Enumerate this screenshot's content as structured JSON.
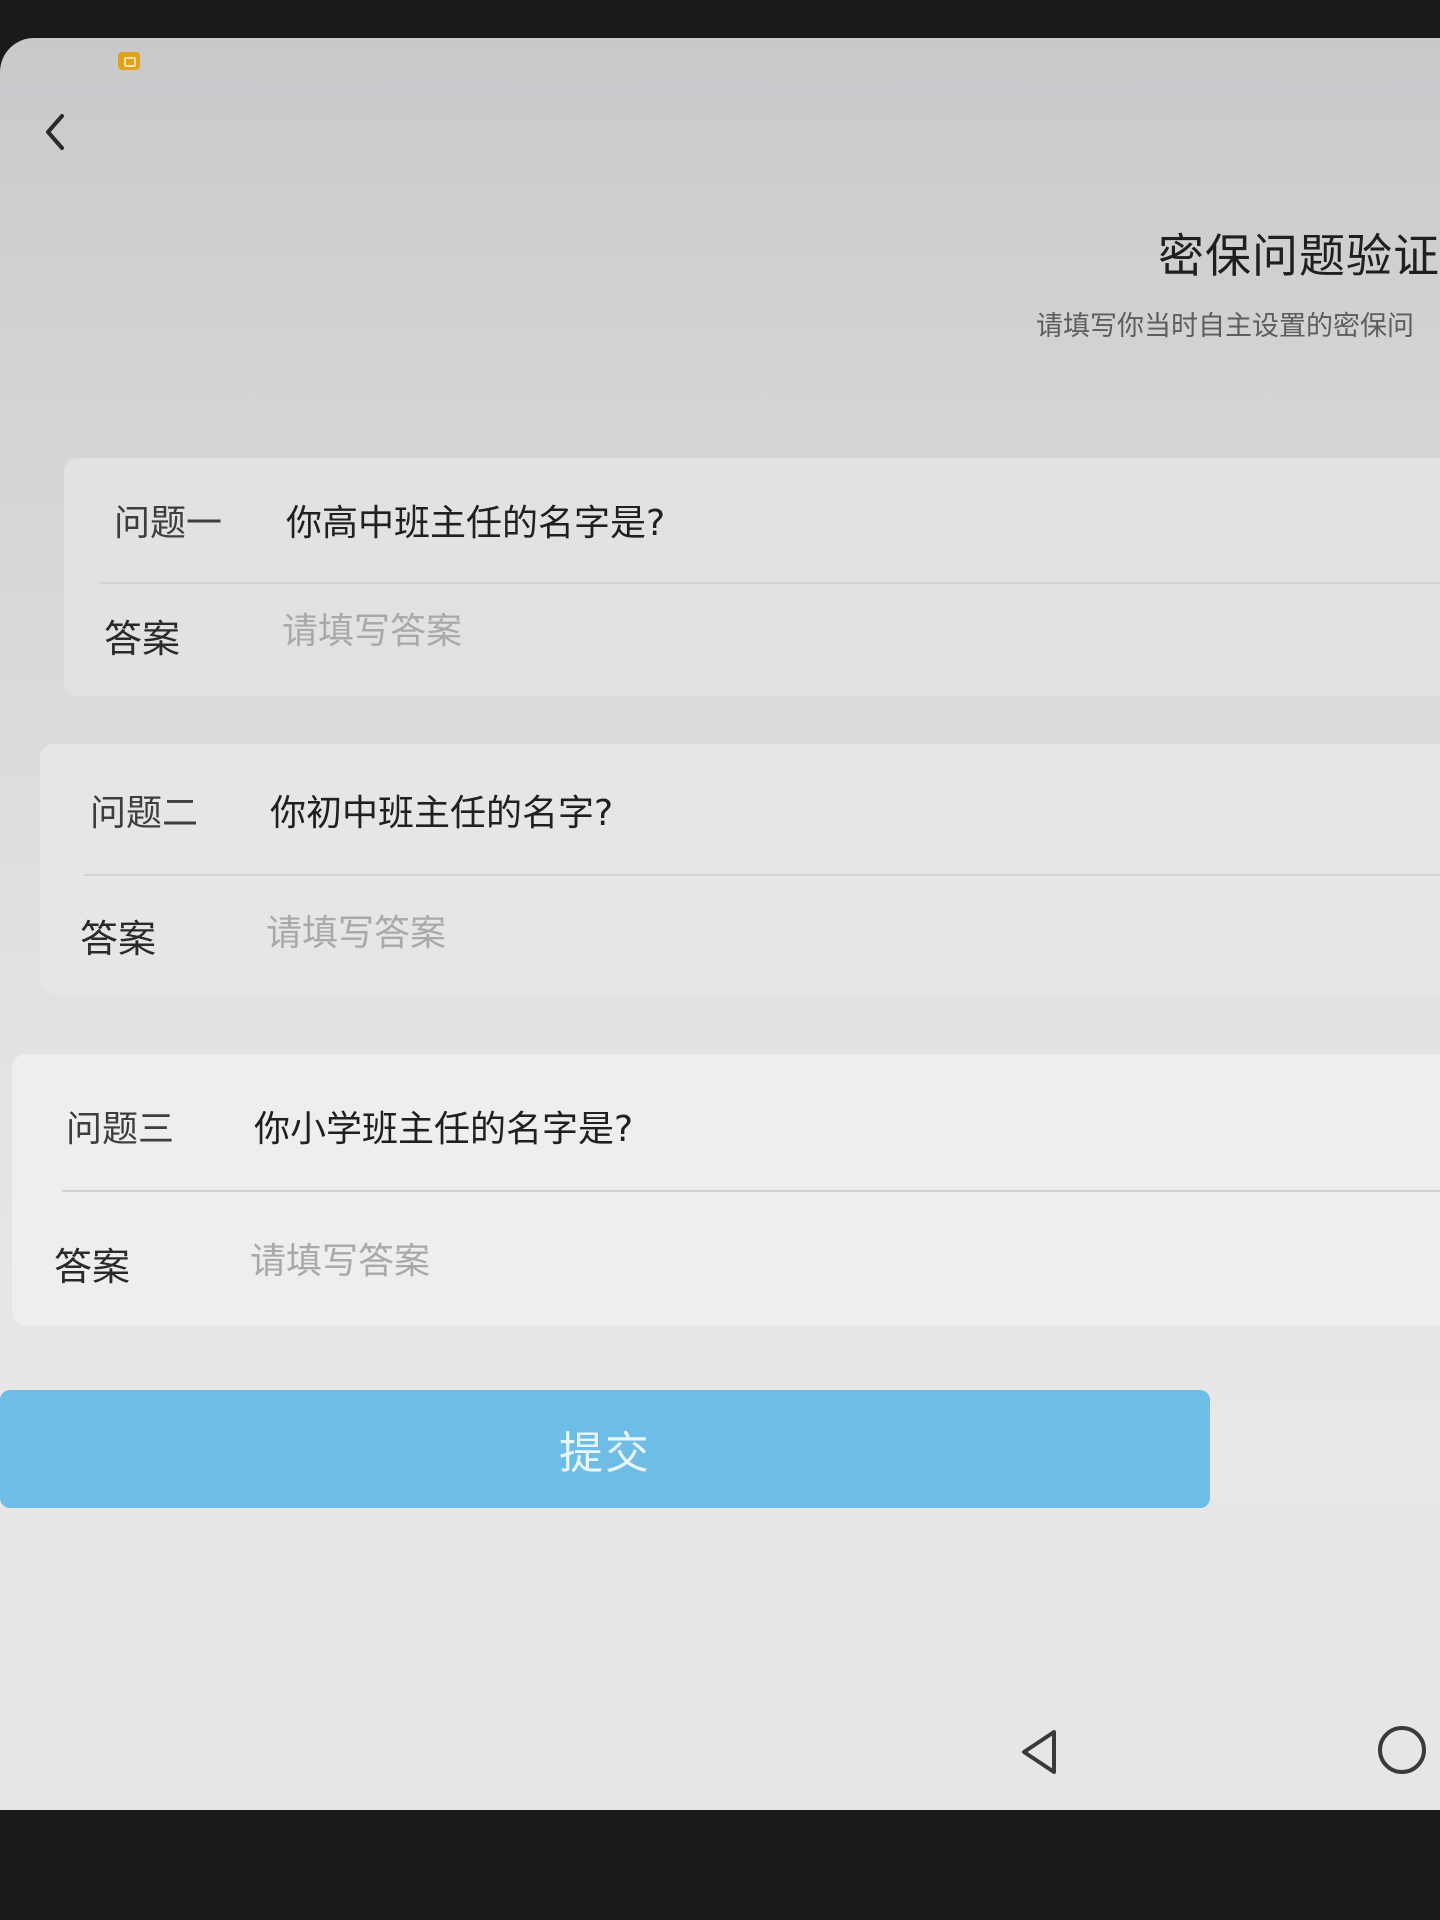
{
  "header": {
    "title": "密保问题验证",
    "subtitle": "请填写你当时自主设置的密保问"
  },
  "questions": [
    {
      "label": "问题一",
      "text": "你高中班主任的名字是?",
      "answer_label": "答案",
      "answer_placeholder": "请填写答案",
      "answer_value": ""
    },
    {
      "label": "问题二",
      "text": "你初中班主任的名字?",
      "answer_label": "答案",
      "answer_placeholder": "请填写答案",
      "answer_value": ""
    },
    {
      "label": "问题三",
      "text": "你小学班主任的名字是?",
      "answer_label": "答案",
      "answer_placeholder": "请填写答案",
      "answer_value": ""
    }
  ],
  "submit_label": "提交",
  "colors": {
    "accent": "#6dbde6",
    "placeholder": "#a9a9ab"
  },
  "icons": {
    "status": "notification-icon",
    "back": "chevron-left-icon",
    "nav_back": "triangle-back-icon",
    "nav_home": "circle-home-icon"
  }
}
